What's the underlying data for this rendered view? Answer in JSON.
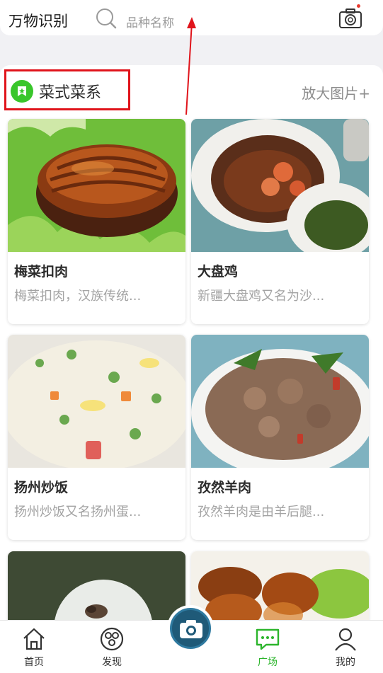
{
  "header": {
    "app_title": "万物识别",
    "search_placeholder": "品种名称",
    "search_icon": "search-icon",
    "camera_icon": "camera-icon"
  },
  "section": {
    "title": "菜式菜系",
    "icon": "badge-icon",
    "enlarge_label": "放大图片+"
  },
  "cards": [
    {
      "title": "梅菜扣肉",
      "desc": "梅菜扣肉，汉族传统..."
    },
    {
      "title": "大盘鸡",
      "desc": "新疆大盘鸡又名为沙..."
    },
    {
      "title": "扬州炒饭",
      "desc": "扬州炒饭又名扬州蛋..."
    },
    {
      "title": "孜然羊肉",
      "desc": "孜然羊肉是由羊后腿..."
    },
    {
      "title": "",
      "desc": ""
    },
    {
      "title": "",
      "desc": ""
    }
  ],
  "bottom_nav": {
    "items": [
      {
        "label": "首页",
        "icon": "home-icon"
      },
      {
        "label": "发现",
        "icon": "discover-icon"
      },
      {
        "label": "广场",
        "icon": "chat-icon"
      },
      {
        "label": "我的",
        "icon": "person-icon"
      }
    ],
    "center_icon": "camera-icon",
    "active": "广场"
  },
  "colors": {
    "accent_green": "#2cb52c",
    "annotation_red": "#e0141b",
    "camera_blue": "#1f5a78"
  }
}
